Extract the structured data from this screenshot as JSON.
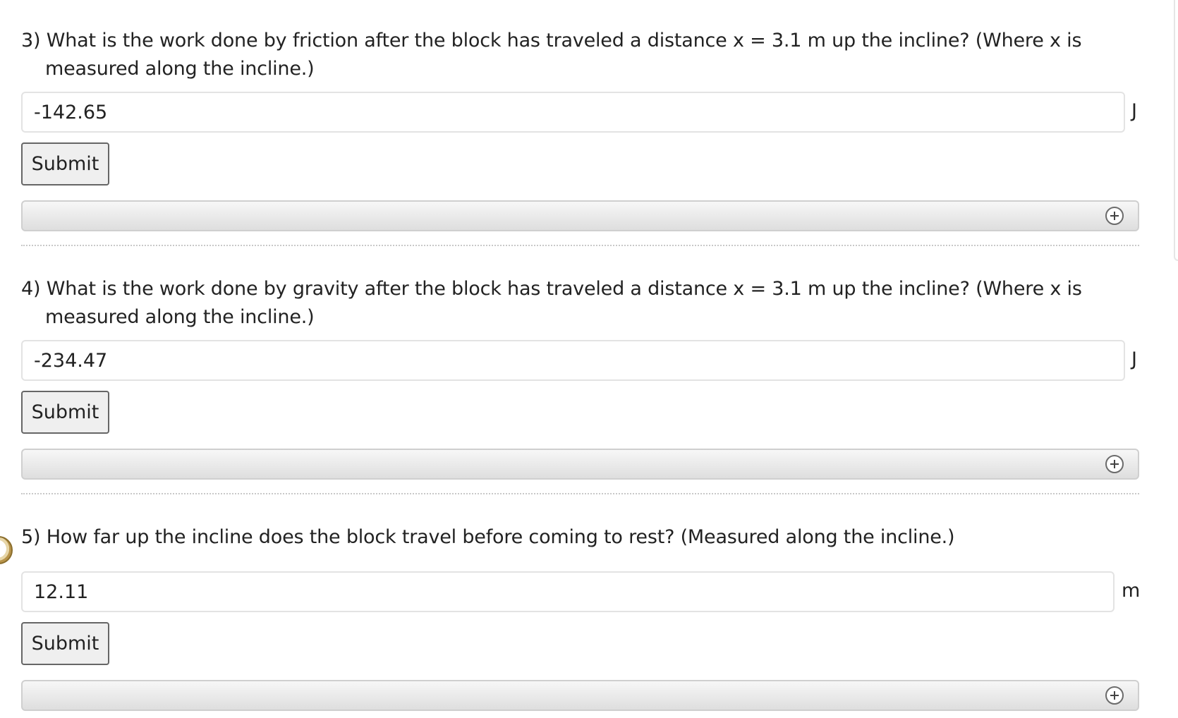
{
  "questions": [
    {
      "text": "3) What is the work done by friction after the block has traveled a distance x = 3.1 m up the incline? (Where x is measured along the incline.)",
      "answer_value": "-142.65",
      "unit": "J",
      "submit_label": "Submit"
    },
    {
      "text": "4) What is the work done by gravity after the block has traveled a distance x = 3.1 m up the incline? (Where x is measured along the incline.)",
      "answer_value": "-234.47",
      "unit": "J",
      "submit_label": "Submit"
    },
    {
      "text": "5) How far up the incline does the block travel before coming to rest? (Measured along the incline.)",
      "answer_value": "12.11",
      "unit": "m",
      "submit_label": "Submit"
    }
  ],
  "icons": {
    "expand": "plus-circle-icon",
    "timer": "clock-icon"
  },
  "colors": {
    "text": "#222222",
    "input_border": "#e3e3e3",
    "button_bg": "#efefef",
    "button_border": "#666666",
    "bar_gradient_top": "#f7f7f7",
    "bar_gradient_bottom": "#dedede",
    "divider": "#c8c8c8"
  }
}
